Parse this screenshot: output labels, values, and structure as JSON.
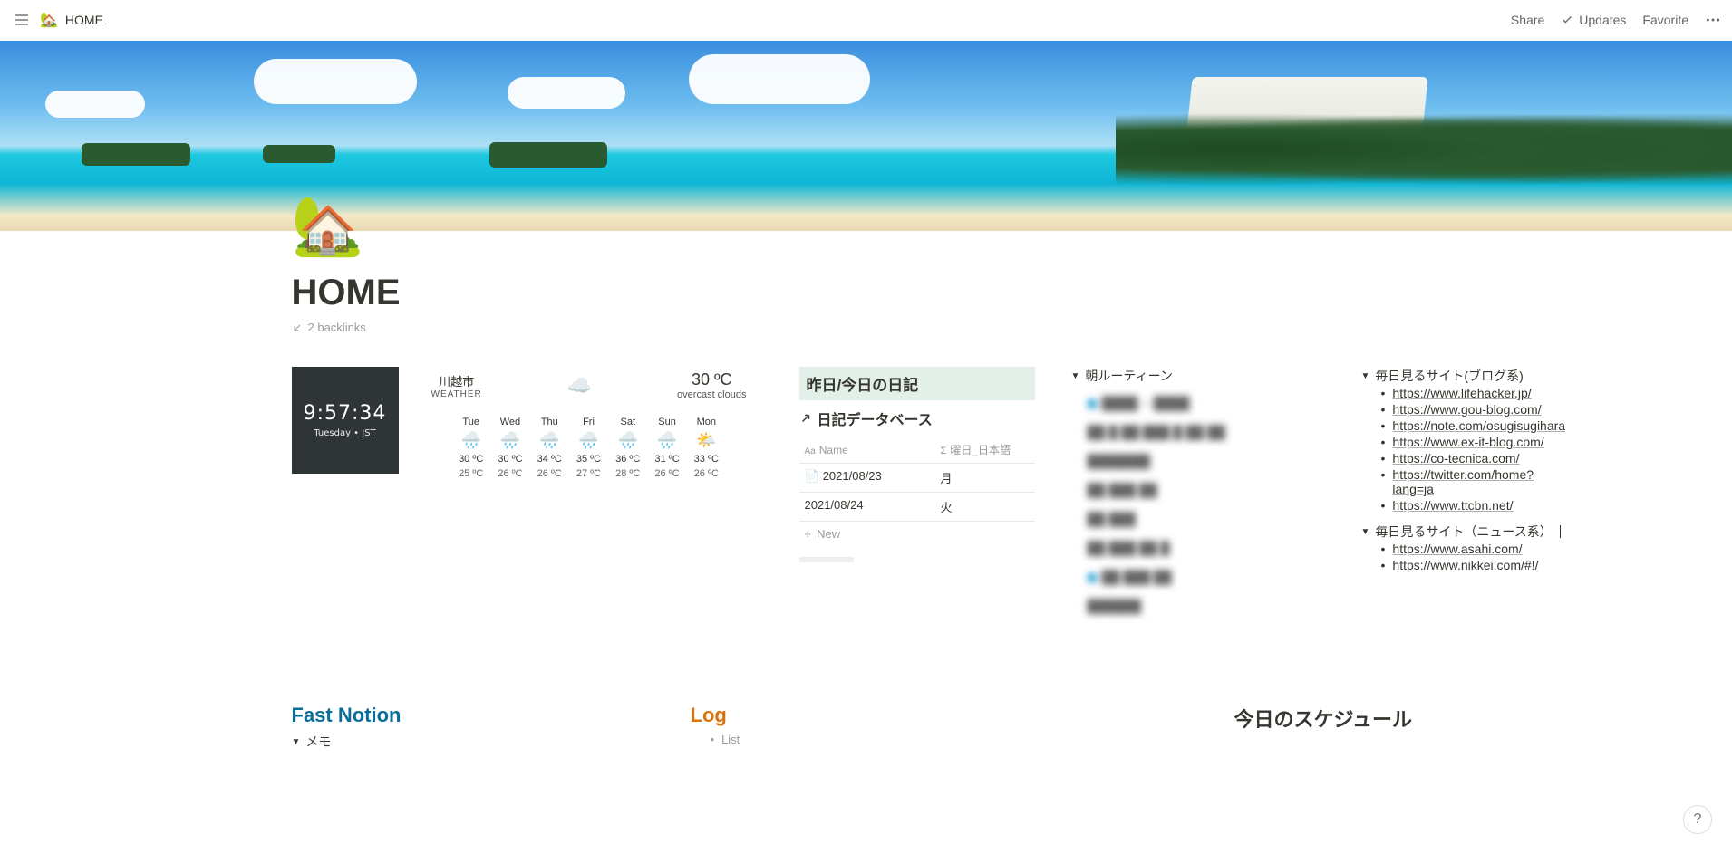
{
  "topbar": {
    "icon": "🏡",
    "title": "HOME",
    "share": "Share",
    "updates": "Updates",
    "favorite": "Favorite"
  },
  "page": {
    "icon": "🏡",
    "title": "HOME",
    "backlinks": "2 backlinks"
  },
  "clock": {
    "time": "9:57:34",
    "sub": "Tuesday • JST"
  },
  "weather": {
    "location": "川越市",
    "location_sub": "WEATHER",
    "temp": "30 ºC",
    "desc": "overcast clouds",
    "forecast": [
      {
        "day": "Tue",
        "hi": "30 ºC",
        "lo": "25 ºC"
      },
      {
        "day": "Wed",
        "hi": "30 ºC",
        "lo": "26 ºC"
      },
      {
        "day": "Thu",
        "hi": "34 ºC",
        "lo": "26 ºC"
      },
      {
        "day": "Fri",
        "hi": "35 ºC",
        "lo": "27 ºC"
      },
      {
        "day": "Sat",
        "hi": "36 ºC",
        "lo": "28 ºC"
      },
      {
        "day": "Sun",
        "hi": "31 ºC",
        "lo": "26 ºC"
      },
      {
        "day": "Mon",
        "hi": "33 ºC",
        "lo": "26 ºC"
      }
    ]
  },
  "diary": {
    "callout": "昨日/今日の日記",
    "link_label": "日記データベース",
    "col_name": "Name",
    "col_day": "曜日_日本語",
    "rows": [
      {
        "name": "2021/08/23",
        "day": "月"
      },
      {
        "name": "2021/08/24",
        "day": "火"
      }
    ],
    "new": "New"
  },
  "routine": {
    "title": "朝ルーティーン"
  },
  "links": {
    "section1_title": "毎日見るサイト(ブログ系)",
    "section1_items": [
      "https://www.lifehacker.jp/",
      "https://www.gou-blog.com/",
      "https://note.com/osugisugihara",
      "https://www.ex-it-blog.com/",
      "https://co-tecnica.com/",
      "https://twitter.com/home?lang=ja",
      "https://www.ttcbn.net/"
    ],
    "section2_title": "毎日見るサイト（ニュース系）",
    "section2_items": [
      "https://www.asahi.com/",
      "https://www.nikkei.com/#!/"
    ]
  },
  "bottom": {
    "fast_notion": "Fast Notion",
    "memo": "メモ",
    "log": "Log",
    "list": "List",
    "schedule": "今日のスケジュール"
  },
  "help": "?"
}
